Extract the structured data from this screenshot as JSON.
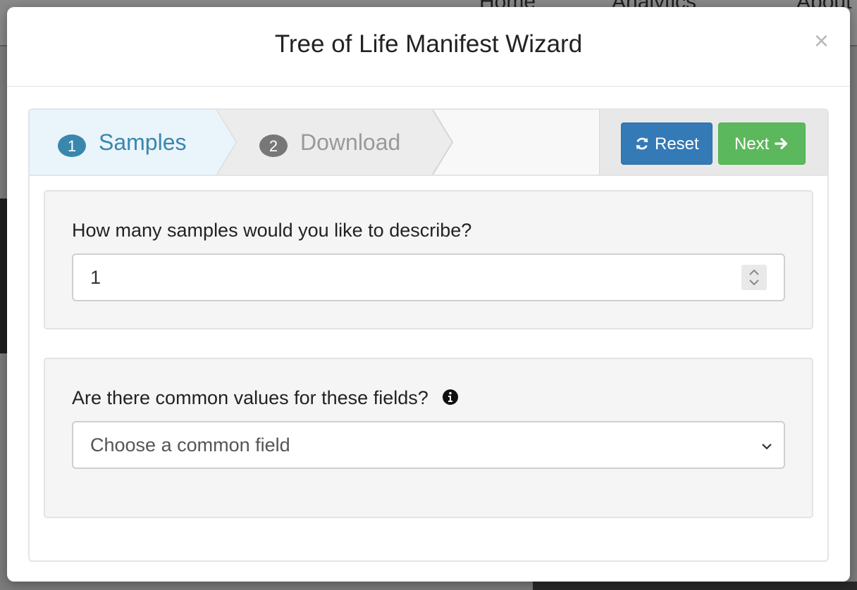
{
  "background": {
    "nav_items": [
      "Home",
      "Analytics",
      "About"
    ]
  },
  "modal": {
    "title": "Tree of Life Manifest Wizard",
    "close_glyph": "×"
  },
  "wizard": {
    "steps": [
      {
        "number": "1",
        "label": "Samples",
        "active": true
      },
      {
        "number": "2",
        "label": "Download",
        "active": false
      }
    ],
    "reset_label": "Reset",
    "next_label": "Next",
    "colors": {
      "active_step_bg": "#eaf4fb",
      "active_step_text": "#3a87ad",
      "inactive_step_bg": "#ececec",
      "inactive_step_text": "#999999",
      "reset_button": "#337ab7",
      "next_button": "#5cb85c"
    }
  },
  "samples": {
    "question": "How many samples would you like to describe?",
    "value": "1"
  },
  "common_fields": {
    "question": "Are there common values for these fields?",
    "selected": "Choose a common field",
    "info_icon": "info-circle-icon"
  }
}
